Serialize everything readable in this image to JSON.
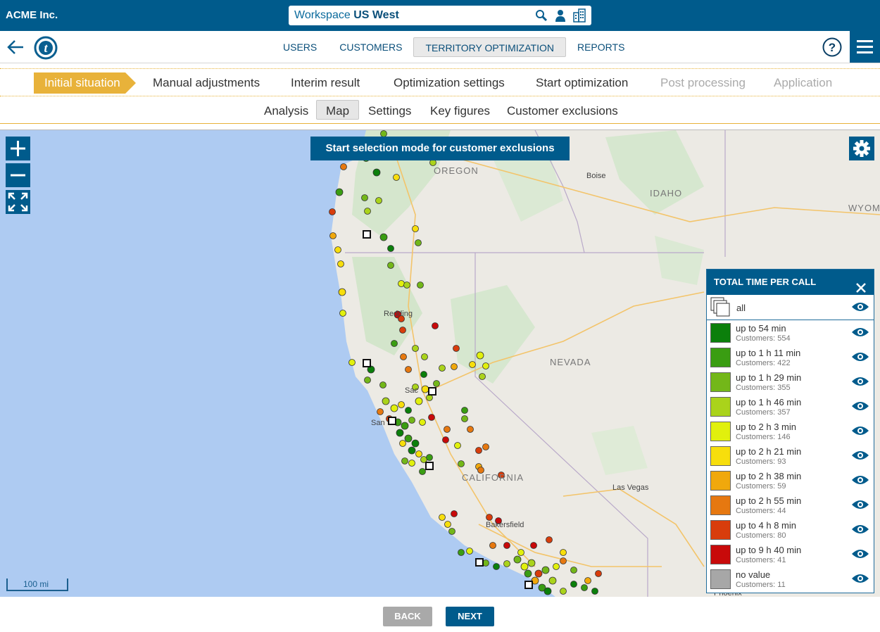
{
  "header": {
    "company": "ACME Inc.",
    "workspace_prefix": "Workspace",
    "workspace_name": "US West"
  },
  "nav": {
    "tabs": [
      {
        "label": "USERS"
      },
      {
        "label": "CUSTOMERS"
      },
      {
        "label": "TERRITORY OPTIMIZATION",
        "active": true
      },
      {
        "label": "REPORTS"
      }
    ]
  },
  "steps": [
    {
      "label": "Initial situation",
      "state": "active"
    },
    {
      "label": "Manual adjustments",
      "state": "normal"
    },
    {
      "label": "Interim result",
      "state": "normal"
    },
    {
      "label": "Optimization settings",
      "state": "normal"
    },
    {
      "label": "Start optimization",
      "state": "normal"
    },
    {
      "label": "Post processing",
      "state": "disabled"
    },
    {
      "label": "Application",
      "state": "disabled"
    }
  ],
  "subtabs": [
    {
      "label": "Analysis"
    },
    {
      "label": "Map",
      "active": true
    },
    {
      "label": "Settings"
    },
    {
      "label": "Key figures"
    },
    {
      "label": "Customer exclusions"
    }
  ],
  "map": {
    "selection_button": "Start selection mode for customer exclusions",
    "scale_label": "100 mi",
    "regions": [
      "OREGON",
      "IDAHO",
      "WYOM",
      "NEVADA",
      "CALIFORNIA"
    ],
    "cities": [
      "Boise",
      "Redding",
      "Sac",
      "San",
      "Bakersfield",
      "Las Vegas",
      "Phoenix"
    ]
  },
  "legend": {
    "title": "TOTAL TIME PER CALL",
    "all_label": "all",
    "items": [
      {
        "label": "up to 54 min",
        "count": "Customers: 554",
        "color": "#0b7f0b"
      },
      {
        "label": "up to 1 h 11 min",
        "count": "Customers: 422",
        "color": "#3a9d12"
      },
      {
        "label": "up to 1 h 29 min",
        "count": "Customers: 355",
        "color": "#73b719"
      },
      {
        "label": "up to 1 h 46 min",
        "count": "Customers: 357",
        "color": "#aad31b"
      },
      {
        "label": "up to 2 h 3 min",
        "count": "Customers: 146",
        "color": "#e1f00d"
      },
      {
        "label": "up to 2 h 21 min",
        "count": "Customers: 93",
        "color": "#f7de0c"
      },
      {
        "label": "up to 2 h 38 min",
        "count": "Customers: 59",
        "color": "#f0a80c"
      },
      {
        "label": "up to 2 h 55 min",
        "count": "Customers: 44",
        "color": "#e67810"
      },
      {
        "label": "up to 4 h 8 min",
        "count": "Customers: 80",
        "color": "#d83d0c"
      },
      {
        "label": "up to 9 h 40 min",
        "count": "Customers: 41",
        "color": "#c80a0a"
      },
      {
        "label": "no value",
        "count": "Customers: 11",
        "color": "#a7a7a7"
      }
    ]
  },
  "footer": {
    "back": "BACK",
    "next": "NEXT"
  }
}
